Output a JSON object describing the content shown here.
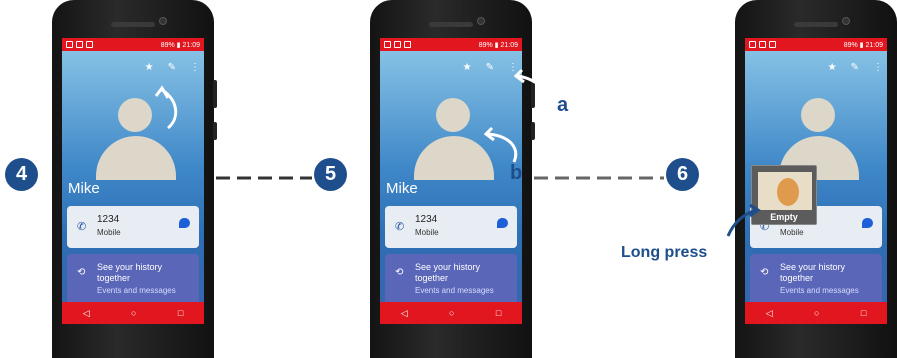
{
  "status": {
    "battery_time": "89% ▮ 21:09"
  },
  "contact": {
    "name": "Mike",
    "number": "1234",
    "number_type": "Mobile",
    "history_title": "See your history together",
    "history_sub": "Events and messages"
  },
  "icons": {
    "star": "star-icon",
    "edit": "pencil-icon",
    "more": "more-vert-icon",
    "call": "phone-icon",
    "message": "message-icon",
    "history": "history-icon",
    "back": "back-icon",
    "home": "home-icon",
    "recents": "recents-icon"
  },
  "steps": {
    "s4": "4",
    "s5": "5",
    "s6": "6"
  },
  "annotations": {
    "a": "a",
    "b": "b",
    "long_press": "Long press",
    "empty": "Empty"
  },
  "colors": {
    "accent_blue": "#1e4e8c",
    "status_red": "#e1161e"
  }
}
